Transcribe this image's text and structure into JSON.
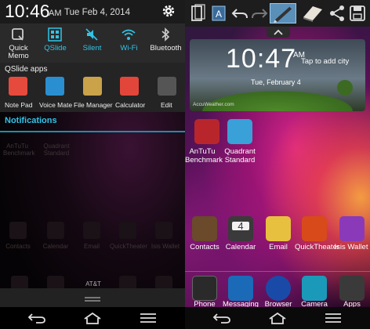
{
  "left": {
    "status": {
      "time": "10:46",
      "ampm": "AM",
      "date": "Tue Feb 4, 2014"
    },
    "toggles": [
      {
        "label": "Quick\nMemo",
        "icon": "quick-memo-icon",
        "on": false
      },
      {
        "label": "QSlide",
        "icon": "qslide-icon",
        "on": true
      },
      {
        "label": "Silent",
        "icon": "silent-icon",
        "on": true
      },
      {
        "label": "Wi-Fi",
        "icon": "wifi-icon",
        "on": true
      },
      {
        "label": "Bluetooth",
        "icon": "bluetooth-icon",
        "on": false
      }
    ],
    "qslide_title": "QSlide apps",
    "qslide_apps": [
      {
        "label": "Note Pad",
        "icon": "notepad-icon",
        "color": "#e64a3c"
      },
      {
        "label": "Voice Mate",
        "icon": "microphone-icon",
        "color": "#2a8fd0"
      },
      {
        "label": "File Manager",
        "icon": "folder-icon",
        "color": "#c9a24a"
      },
      {
        "label": "Calculator",
        "icon": "calculator-icon",
        "color": "#e2463a"
      },
      {
        "label": "Edit",
        "icon": "edit-icon",
        "color": "#555555"
      }
    ],
    "notifications_title": "Notifications",
    "dimmed_apps_row1": [
      "AnTuTu\nBenchmark",
      "Quadrant\nStandard"
    ],
    "dimmed_apps_row2": [
      "Contacts",
      "Calendar",
      "Email",
      "QuickTheater",
      "Isis Wallet"
    ],
    "carrier": "AT&T"
  },
  "right": {
    "toolbar": [
      "screen-capture-icon",
      "text-icon",
      "undo-icon",
      "redo-icon",
      "pen-icon",
      "eraser-icon",
      "share-icon",
      "save-icon"
    ],
    "widget": {
      "time": "10:47",
      "ampm": "AM",
      "tap": "Tap to add city",
      "date": "Tue, February 4",
      "credit": "AccuWeather.com"
    },
    "apps_top": [
      {
        "label": "AnTuTu\nBenchmark",
        "icon": "antutu-icon",
        "color": "#b8262b"
      },
      {
        "label": "Quadrant\nStandard",
        "icon": "quadrant-icon",
        "color": "#3aa0d8"
      }
    ],
    "apps_row": [
      {
        "label": "Contacts",
        "icon": "contacts-icon",
        "color": "#6a4a2a"
      },
      {
        "label": "Calendar",
        "icon": "calendar-icon",
        "color": "#3a3a3a",
        "badge": "4"
      },
      {
        "label": "Email",
        "icon": "email-icon",
        "color": "#e8c040"
      },
      {
        "label": "QuickTheater",
        "icon": "quicktheater-icon",
        "color": "#d84a1a"
      },
      {
        "label": "Isis Wallet",
        "icon": "isis-wallet-icon",
        "color": "#8a3ab8"
      }
    ],
    "dock": [
      {
        "label": "Phone",
        "icon": "phone-icon",
        "color": "#2a2a2a"
      },
      {
        "label": "Messaging",
        "icon": "messaging-icon",
        "color": "#1a6ab8"
      },
      {
        "label": "Browser",
        "icon": "browser-icon",
        "color": "#1a4aa8"
      },
      {
        "label": "Camera",
        "icon": "camera-icon",
        "color": "#1a9ab8"
      },
      {
        "label": "Apps",
        "icon": "apps-icon",
        "color": "#3a3a3a"
      }
    ]
  },
  "nav": [
    "back-icon",
    "home-icon",
    "menu-icon"
  ]
}
